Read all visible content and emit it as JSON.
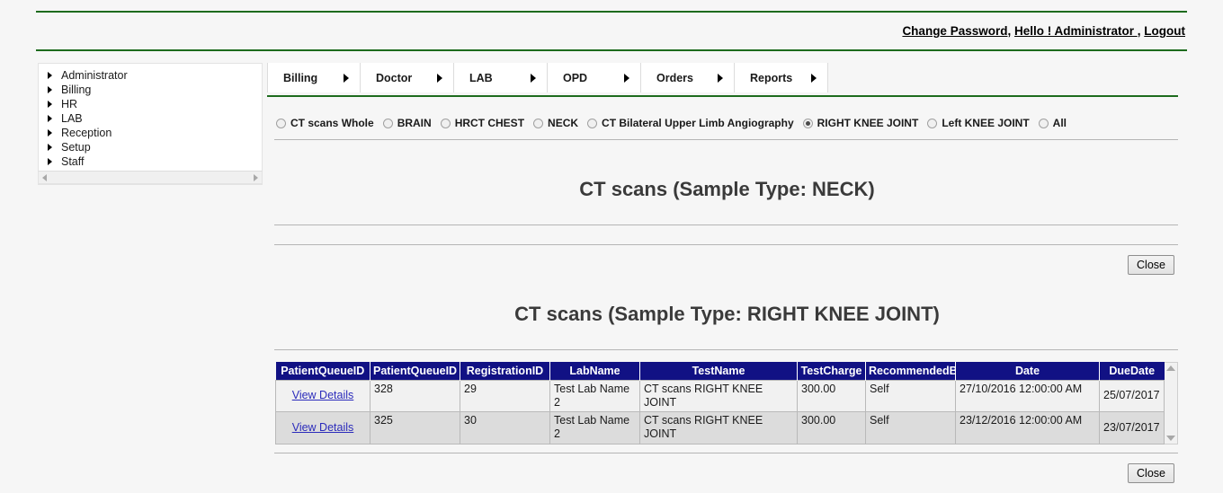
{
  "header": {
    "change_password": "Change Password",
    "separator1": ", ",
    "hello_admin": "Hello ! Administrator ",
    "separator2": ", ",
    "logout": "Logout"
  },
  "sidebar": {
    "items": [
      {
        "label": "Administrator"
      },
      {
        "label": "Billing"
      },
      {
        "label": "HR"
      },
      {
        "label": "LAB"
      },
      {
        "label": "Reception"
      },
      {
        "label": "Setup"
      },
      {
        "label": "Staff"
      }
    ]
  },
  "menubar": {
    "items": [
      {
        "label": "Billing"
      },
      {
        "label": "Doctor"
      },
      {
        "label": "LAB"
      },
      {
        "label": "OPD"
      },
      {
        "label": "Orders"
      },
      {
        "label": "Reports"
      }
    ]
  },
  "sample_type_filter": {
    "options": [
      {
        "label": "CT scans Whole",
        "checked": false
      },
      {
        "label": "BRAIN",
        "checked": false
      },
      {
        "label": "HRCT CHEST",
        "checked": false
      },
      {
        "label": "NECK",
        "checked": false
      },
      {
        "label": "CT Bilateral Upper Limb Angiography",
        "checked": false
      },
      {
        "label": "RIGHT KNEE JOINT",
        "checked": true
      },
      {
        "label": "Left KNEE JOINT",
        "checked": false
      },
      {
        "label": "All",
        "checked": false
      }
    ]
  },
  "section_neck": {
    "title": "CT scans (Sample Type: NECK)",
    "close_label": "Close"
  },
  "section_right_knee": {
    "title": "CT scans (Sample Type: RIGHT KNEE JOINT)",
    "close_label": "Close",
    "table": {
      "columns": [
        "PatientQueueID",
        "PatientQueueID",
        "RegistrationID",
        "LabName",
        "TestName",
        "TestCharge",
        "RecommendedBy",
        "Date",
        "DueDate"
      ],
      "rows": [
        {
          "action": "View Details",
          "patient_queue_id": "328",
          "registration_id": "29",
          "lab_name": "Test Lab Name 2",
          "test_name": "CT scans RIGHT KNEE JOINT",
          "test_charge": "300.00",
          "recommended_by": "Self",
          "date": "27/10/2016 12:00:00 AM",
          "due_date": "25/07/2017"
        },
        {
          "action": "View Details",
          "patient_queue_id": "325",
          "registration_id": "30",
          "lab_name": "Test Lab Name 2",
          "test_name": "CT scans RIGHT KNEE JOINT",
          "test_charge": "300.00",
          "recommended_by": "Self",
          "date": "23/12/2016 12:00:00 AM",
          "due_date": "23/07/2017"
        }
      ]
    }
  },
  "colors": {
    "accent_green": "#1d6b1d",
    "table_header_blue": "#111184",
    "link_blue": "#2b2bbb",
    "page_background": "#f6f6f6"
  }
}
